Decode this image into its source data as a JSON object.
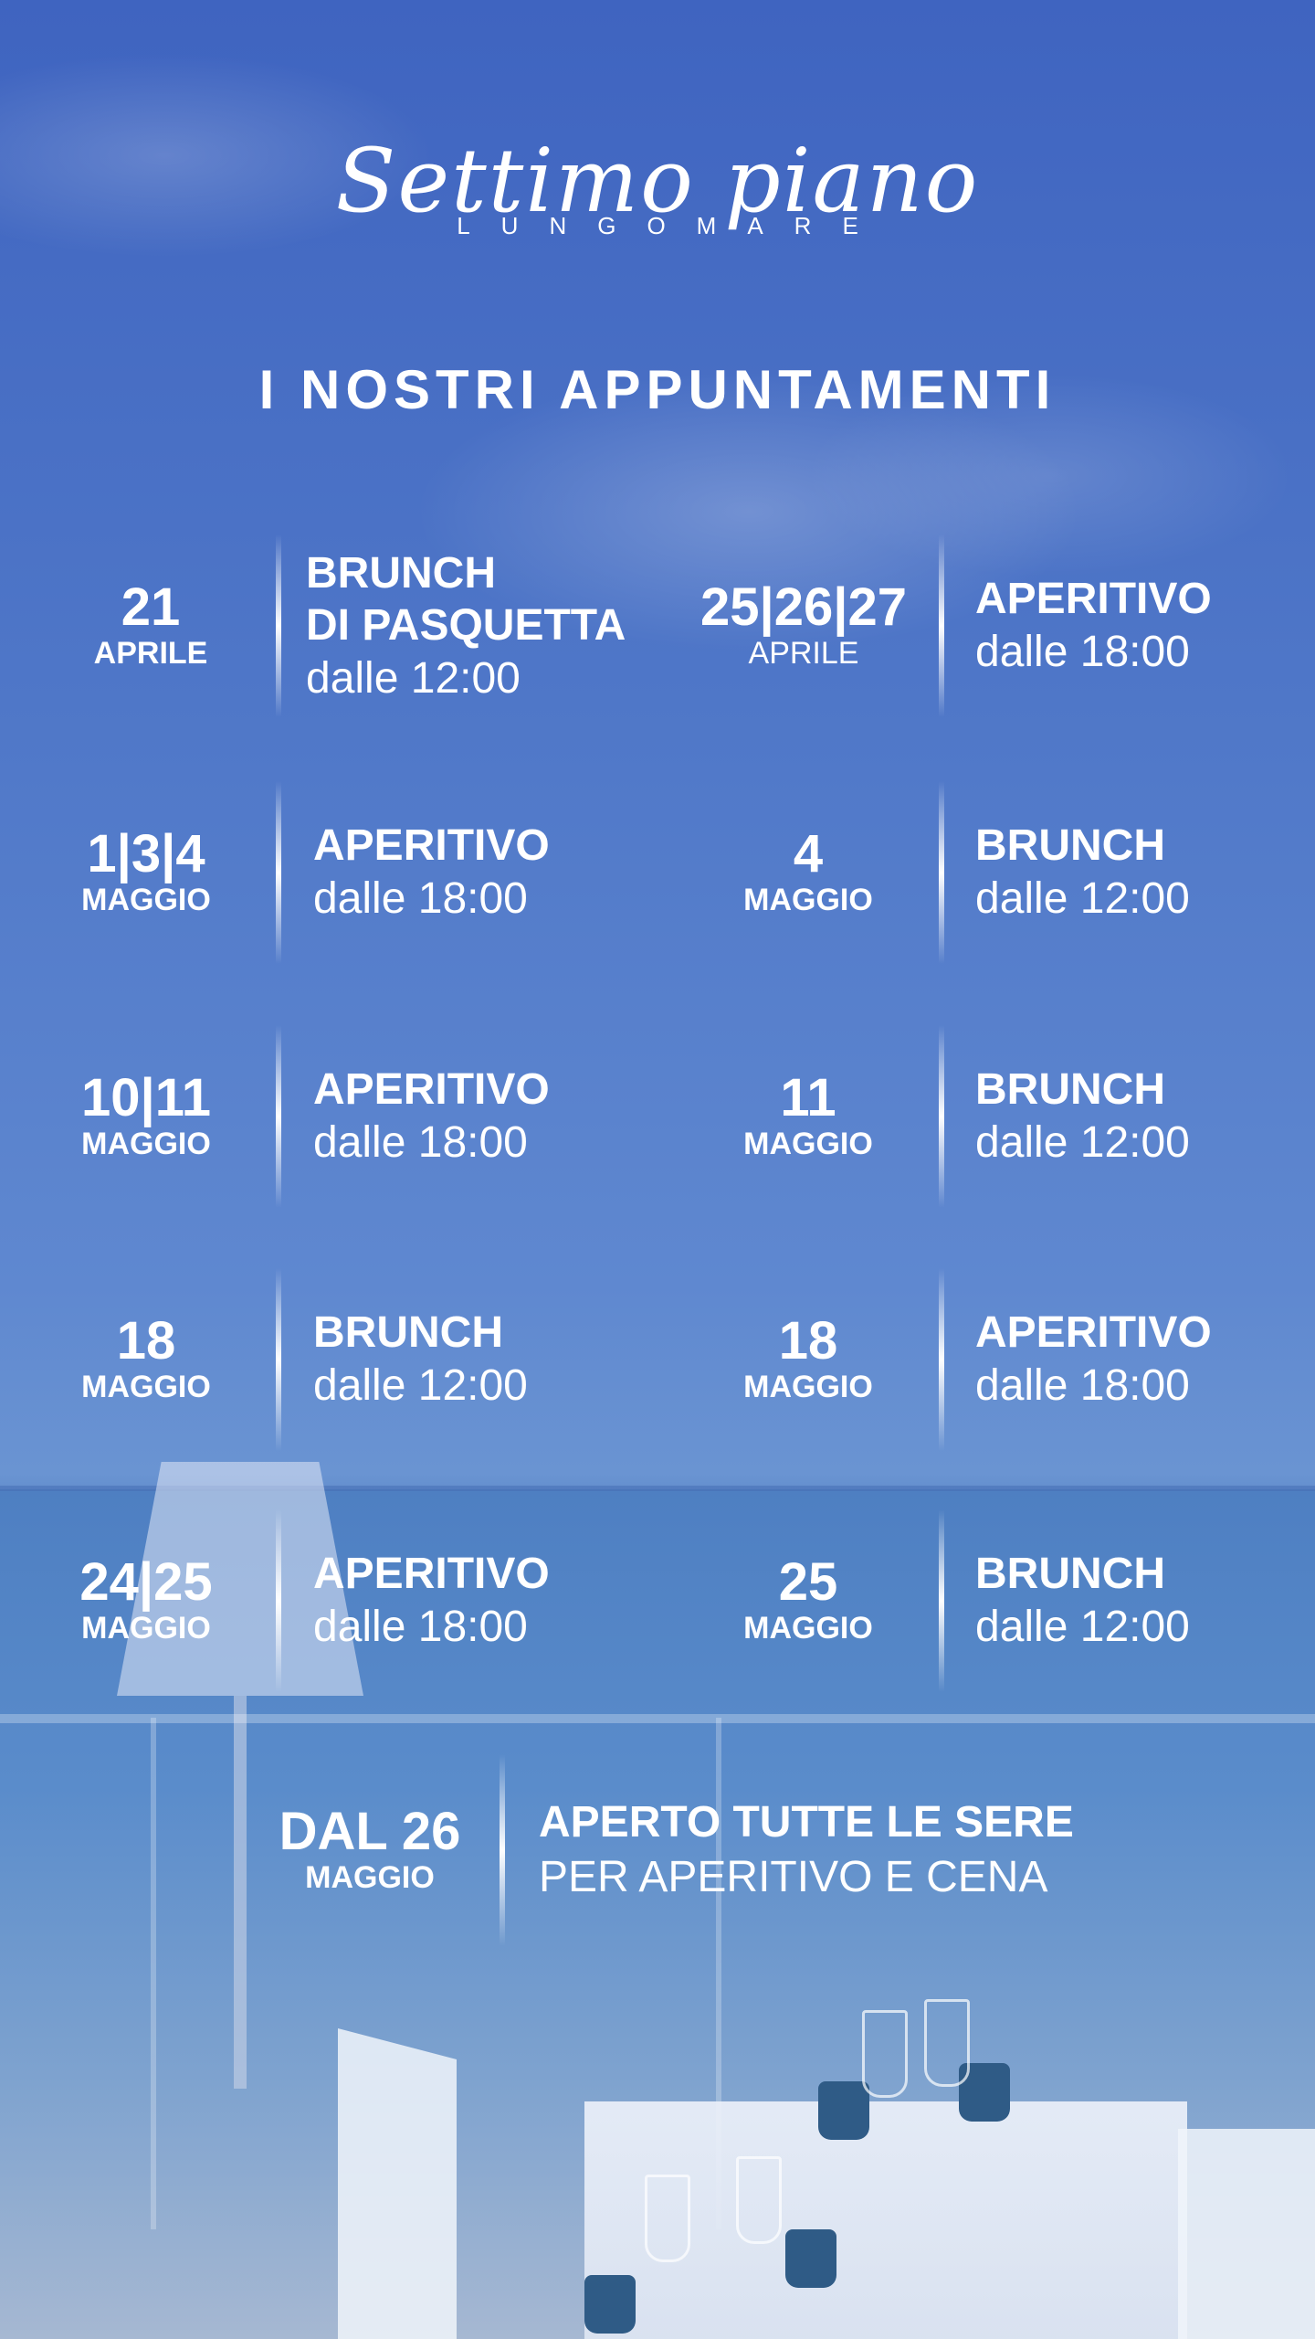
{
  "logo": {
    "script": "Settimo piano",
    "sub": "LUNGOMARE"
  },
  "heading": "I NOSTRI APPUNTAMENTI",
  "events": [
    {
      "date": "21",
      "month": "APRILE",
      "title": "BRUNCH",
      "title2": "DI PASQUETTA",
      "time": "dalle 12:00"
    },
    {
      "date": "25|26|27",
      "month": "APRILE",
      "title": "APERITIVO",
      "time": "dalle 18:00"
    },
    {
      "date": "1|3|4",
      "month": "MAGGIO",
      "title": "APERITIVO",
      "time": "dalle 18:00"
    },
    {
      "date": "4",
      "month": "MAGGIO",
      "title": "BRUNCH",
      "time": "dalle 12:00"
    },
    {
      "date": "10|11",
      "month": "MAGGIO",
      "title": "APERITIVO",
      "time": "dalle 18:00"
    },
    {
      "date": "11",
      "month": "MAGGIO",
      "title": "BRUNCH",
      "time": "dalle 12:00"
    },
    {
      "date": "18",
      "month": "MAGGIO",
      "title": "BRUNCH",
      "time": "dalle 12:00"
    },
    {
      "date": "18",
      "month": "MAGGIO",
      "title": "APERITIVO",
      "time": "dalle 18:00"
    },
    {
      "date": "24|25",
      "month": "MAGGIO",
      "title": "APERITIVO",
      "time": "dalle 18:00"
    },
    {
      "date": "25",
      "month": "MAGGIO",
      "title": "BRUNCH",
      "time": "dalle 12:00"
    }
  ],
  "final": {
    "date": "DAL 26",
    "month": "MAGGIO",
    "line1": "APERTO TUTTE LE SERE",
    "line2": "PER APERITIVO E CENA"
  }
}
